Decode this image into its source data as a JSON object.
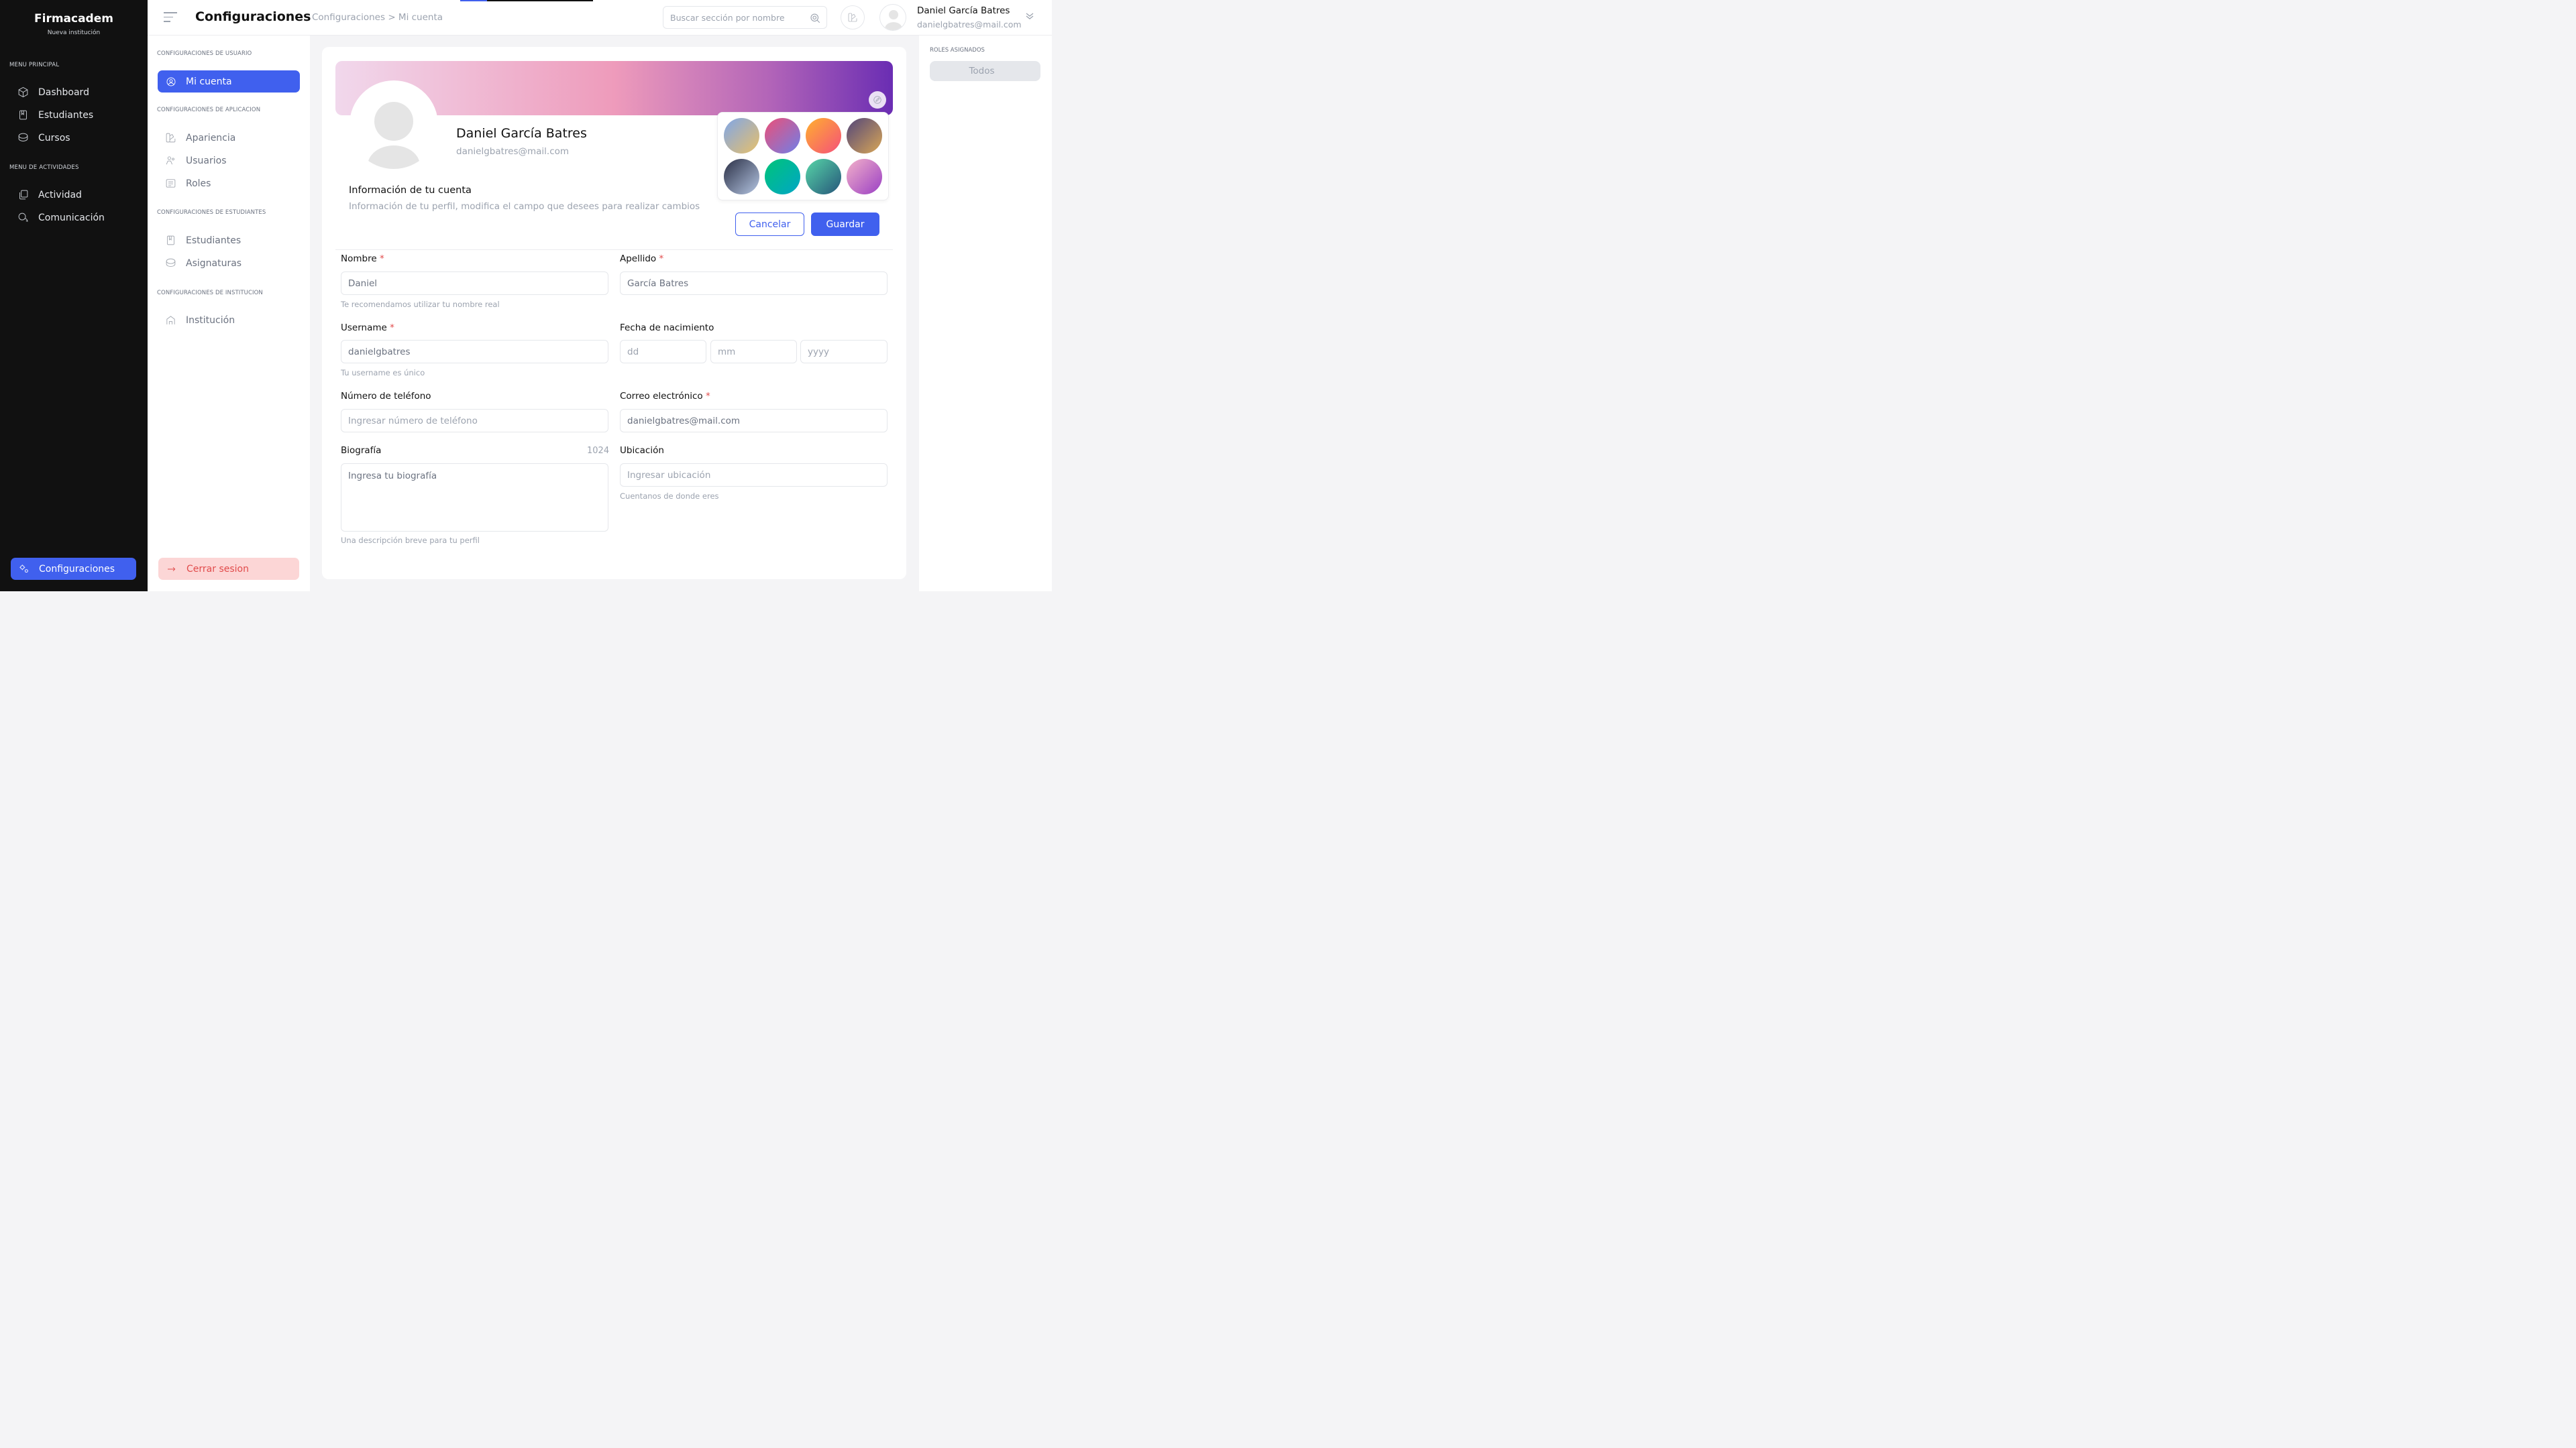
{
  "brand": {
    "name": "Firmacadem",
    "subtitle": "Nueva institución"
  },
  "sidebar": {
    "menu_principal_title": "MENU PRINCIPAL",
    "menu_principal": [
      {
        "label": "Dashboard",
        "icon": "cube-icon"
      },
      {
        "label": "Estudiantes",
        "icon": "book-icon"
      },
      {
        "label": "Cursos",
        "icon": "database-icon"
      }
    ],
    "menu_actividades_title": "MENU DE ACTIVIDADES",
    "menu_actividades": [
      {
        "label": "Actividad",
        "icon": "copy-icon"
      },
      {
        "label": "Comunicación",
        "icon": "chat-icon"
      }
    ],
    "config_label": "Configuraciones"
  },
  "header": {
    "title": "Configuraciones",
    "breadcrumb": "Configuraciones > Mi cuenta",
    "search_placeholder": "Buscar sección por nombre",
    "user_name": "Daniel García Batres",
    "user_email": "danielgbatres@mail.com"
  },
  "settings": {
    "usuario_title": "CONFIGURACIONES DE USUARIO",
    "active_item": "Mi cuenta",
    "aplicacion_title": "CONFIGURACIONES DE APLICACION",
    "aplicacion_items": [
      {
        "label": "Apariencia",
        "icon": "palette-icon"
      },
      {
        "label": "Usuarios",
        "icon": "users-icon"
      },
      {
        "label": "Roles",
        "icon": "list-icon"
      }
    ],
    "estudiantes_title": "CONFIGURACIONES DE ESTUDIANTES",
    "estudiantes_items": [
      {
        "label": "Estudiantes",
        "icon": "book-icon"
      },
      {
        "label": "Asignaturas",
        "icon": "database-icon"
      }
    ],
    "institucion_title": "CONFIGURACIONES DE INSTITUCION",
    "institucion_items": [
      {
        "label": "Institución",
        "icon": "home-icon"
      }
    ],
    "logout_label": "Cerrar sesion"
  },
  "roles": {
    "title": "ROLES ASIGNADOS",
    "value": "Todos"
  },
  "profile": {
    "name": "Daniel García Batres",
    "email": "danielgbatres@mail.com",
    "info_title": "Información de tu cuenta",
    "info_desc": "Información de tu perfil, modifica el campo que desees para realizar cambios",
    "cancel_label": "Cancelar",
    "save_label": "Guardar"
  },
  "palette": [
    [
      "#7fa6e8",
      "#e8c06a"
    ],
    [
      "#ec4f77",
      "#6f7fe8"
    ],
    [
      "#ffb02e",
      "#f5507a"
    ],
    [
      "#52467a",
      "#d9a656"
    ],
    [
      "#2a2f45",
      "#b5c6e3"
    ],
    [
      "#00c478",
      "#00a6c7"
    ],
    [
      "#57d6a8",
      "#26557a"
    ],
    [
      "#f3b1c9",
      "#9a3fc4"
    ]
  ],
  "form": {
    "nombre_label": "Nombre",
    "nombre_value": "Daniel",
    "nombre_help": "Te recomendamos utilizar tu nombre real",
    "apellido_label": "Apellido",
    "apellido_value": "García Batres",
    "username_label": "Username",
    "username_value": "danielgbatres",
    "username_help": "Tu username es único",
    "fecha_label": "Fecha de nacimiento",
    "fecha_dd": "dd",
    "fecha_mm": "mm",
    "fecha_yyyy": "yyyy",
    "telefono_label": "Número de teléfono",
    "telefono_placeholder": "Ingresar número de teléfono",
    "correo_label": "Correo electrónico",
    "correo_value": "danielgbatres@mail.com",
    "bio_label": "Biografía",
    "bio_counter": "1024",
    "bio_placeholder": "Ingresa tu biografía",
    "bio_help": "Una descripción breve para tu perfil",
    "ubicacion_label": "Ubicación",
    "ubicacion_placeholder": "Ingresar ubicación",
    "ubicacion_help": "Cuentanos de donde eres",
    "required_mark": "*"
  },
  "colors": {
    "accent": "#4060ee",
    "danger": "#e14b4b",
    "sidebar_bg": "#111111"
  }
}
